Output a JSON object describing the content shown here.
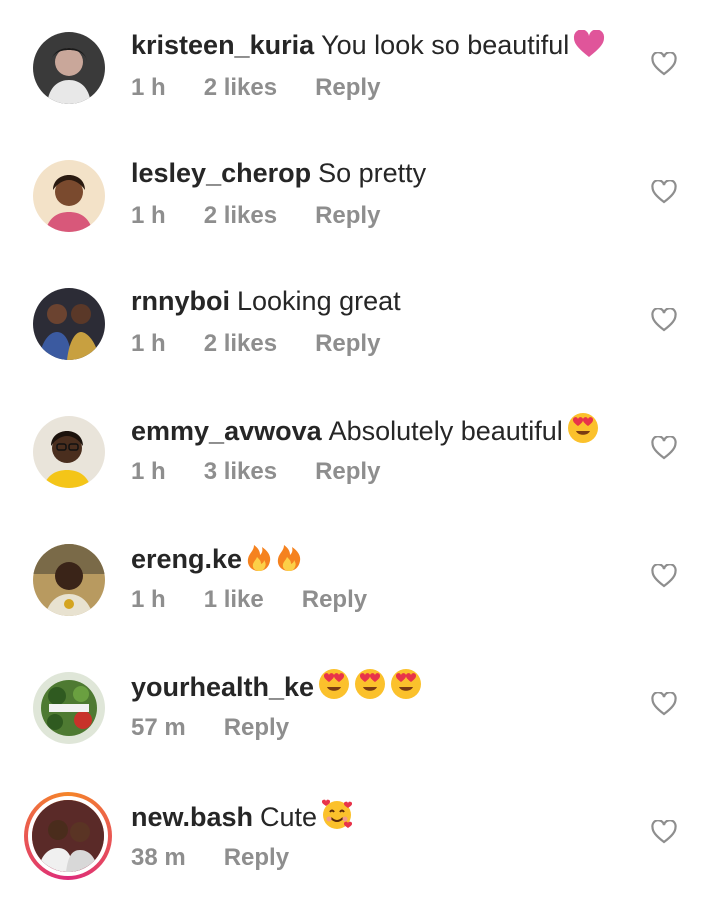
{
  "comments": [
    {
      "username": "kristeen_kuria",
      "text": "You look so beautiful",
      "emojis": [
        "pink-heart-icon"
      ],
      "time": "1 h",
      "likes": "2 likes",
      "reply": "Reply"
    },
    {
      "username": "lesley_cherop",
      "text": "So pretty",
      "emojis": [],
      "time": "1 h",
      "likes": "2 likes",
      "reply": "Reply"
    },
    {
      "username": "rnnyboi",
      "text": "Looking great",
      "emojis": [],
      "time": "1 h",
      "likes": "2 likes",
      "reply": "Reply"
    },
    {
      "username": "emmy_avwova",
      "text": "Absolutely beautiful",
      "emojis": [
        "heart-eyes-emoji-icon"
      ],
      "time": "1 h",
      "likes": "3 likes",
      "reply": "Reply"
    },
    {
      "username": "ereng.ke",
      "text": "",
      "emojis": [
        "fire-emoji-icon",
        "fire-emoji-icon"
      ],
      "time": "1 h",
      "likes": "1 like",
      "reply": "Reply"
    },
    {
      "username": "yourhealth_ke",
      "text": "",
      "emojis": [
        "heart-eyes-emoji-icon",
        "heart-eyes-emoji-icon",
        "heart-eyes-emoji-icon"
      ],
      "time": "57 m",
      "likes": "",
      "reply": "Reply"
    },
    {
      "username": "new.bash",
      "text": "Cute",
      "emojis": [
        "smiling-face-with-hearts-icon"
      ],
      "time": "38 m",
      "likes": "",
      "reply": "Reply"
    }
  ],
  "colors": {
    "username": "#262626",
    "meta": "#8e8e8e",
    "heart_outline": "#8e8e8e",
    "pink_heart": "#e0559a",
    "emoji_yellow": "#fbc12c"
  }
}
